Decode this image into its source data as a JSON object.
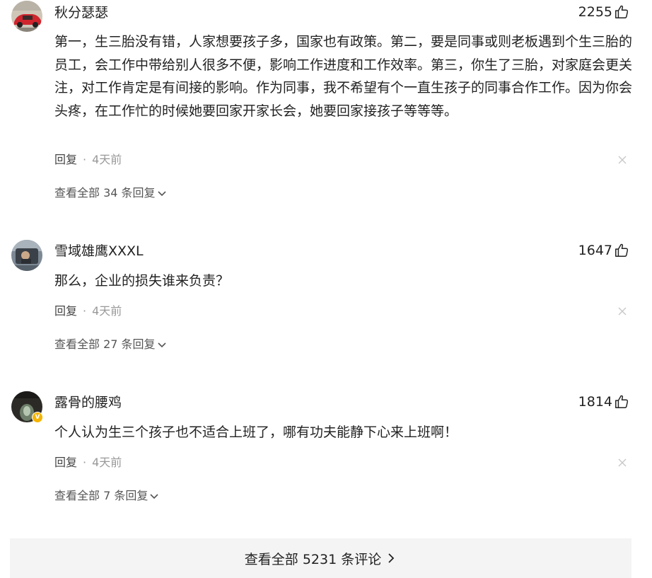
{
  "comments": [
    {
      "username": "秋分瑟瑟",
      "likes": "2255",
      "text": "第一，生三胎没有错，人家想要孩子多，国家也有政策。第二，要是同事或则老板遇到个生三胎的员工，会工作中带给别人很多不便，影响工作进度和工作效率。第三，你生了三胎，对家庭会更关注，对工作肯定是有间接的影响。作为同事，我不希望有个一直生孩子的同事合作工作。因为你会头疼，在工作忙的时候她要回家开家长会，她要回家接孩子等等等。",
      "reply_label": "回复",
      "separator": "·",
      "time": "4天前",
      "view_replies": "查看全部 34 条回复",
      "avatar_icon": "red-car-avatar",
      "like_icon": "thumbs-up-icon",
      "close_icon": "close-icon"
    },
    {
      "username": "雪域雄鹰XXXL",
      "likes": "1647",
      "text": "那么，企业的损失谁来负责？",
      "reply_label": "回复",
      "separator": "·",
      "time": "4天前",
      "view_replies": "查看全部 27 条回复",
      "avatar_icon": "car-window-avatar",
      "like_icon": "thumbs-up-icon",
      "close_icon": "close-icon"
    },
    {
      "username": "露骨的腰鸡",
      "likes": "1814",
      "text": "个人认为生三个孩子也不适合上班了，哪有功夫能静下心来上班啊！",
      "reply_label": "回复",
      "separator": "·",
      "time": "4天前",
      "view_replies": "查看全部 7 条回复",
      "avatar_icon": "dark-avatar-verified",
      "like_icon": "thumbs-up-icon",
      "close_icon": "close-icon",
      "verified_badge": "V"
    }
  ],
  "footer": {
    "view_all_comments": "查看全部 5231 条评论",
    "chevron_icon": "chevron-right-icon"
  },
  "colors": {
    "text": "#222222",
    "meta": "#999999",
    "footer_bg": "#f4f4f4",
    "verified": "#f5b400"
  }
}
